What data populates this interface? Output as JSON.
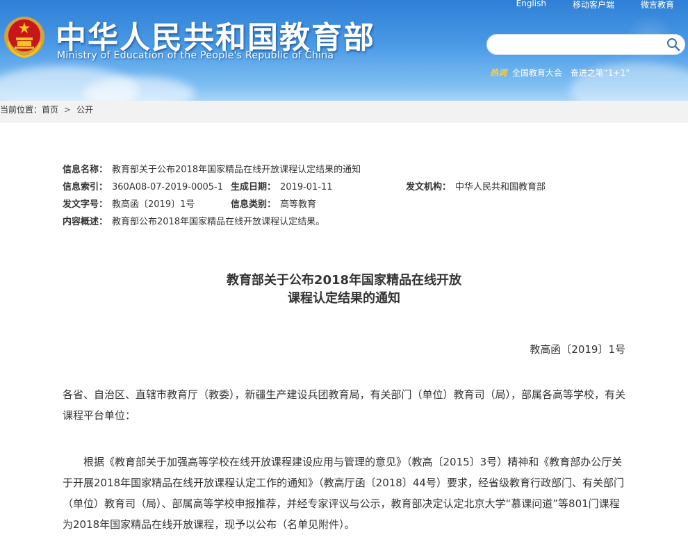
{
  "header": {
    "site_title": "中华人民共和国教育部",
    "site_subtitle": "Ministry of Education of the People's Republic of China",
    "top_links": [
      "English",
      "移动客户端",
      "微言教育"
    ],
    "search_placeholder": "",
    "hot_tag": "热词",
    "hot_links": [
      "全国教育大会",
      "奋进之笔“1+1”"
    ],
    "colors": {
      "banner": "#3a8be0",
      "hot_tag": "#ffd23a"
    }
  },
  "breadcrumb": {
    "prefix": "当前位置：",
    "items": [
      "首页",
      "公开"
    ],
    "separator": ">"
  },
  "meta": {
    "name_label": "信息名称：",
    "name_value": "教育部关于公布2018年国家精品在线开放课程认定结果的通知",
    "index_label": "信息索引：",
    "index_value": "360A08-07-2019-0005-1",
    "date_label": "生成日期：",
    "date_value": "2019-01-11",
    "org_label": "发文机构：",
    "org_value": "中华人民共和国教育部",
    "docno_label": "发文字号：",
    "docno_value": "教高函〔2019〕1号",
    "category_label": "信息类别：",
    "category_value": "高等教育",
    "summary_label": "内容概述：",
    "summary_value": "教育部公布2018年国家精品在线开放课程认定结果。"
  },
  "document": {
    "title_line1": "教育部关于公布2018年国家精品在线开放",
    "title_line2": "课程认定结果的通知",
    "doc_number": "教高函〔2019〕1号",
    "salutation": "各省、自治区、直辖市教育厅（教委），新疆生产建设兵团教育局，有关部门（单位）教育司（局），部属各高等学校，有关课程平台单位：",
    "paragraph1": "根据《教育部关于加强高等学校在线开放课程建设应用与管理的意见》（教高〔2015〕3号）精神和《教育部办公厅关于开展2018年国家精品在线开放课程认定工作的通知》（教高厅函〔2018〕44号）要求，经省级教育行政部门、有关部门（单位）教育司（局）、部属高等学校申报推荐，并经专家评议与公示，教育部决定认定北京大学“慕课问道”等801门课程为2018年国家精品在线开放课程，现予以公布（名单见附件）。"
  }
}
